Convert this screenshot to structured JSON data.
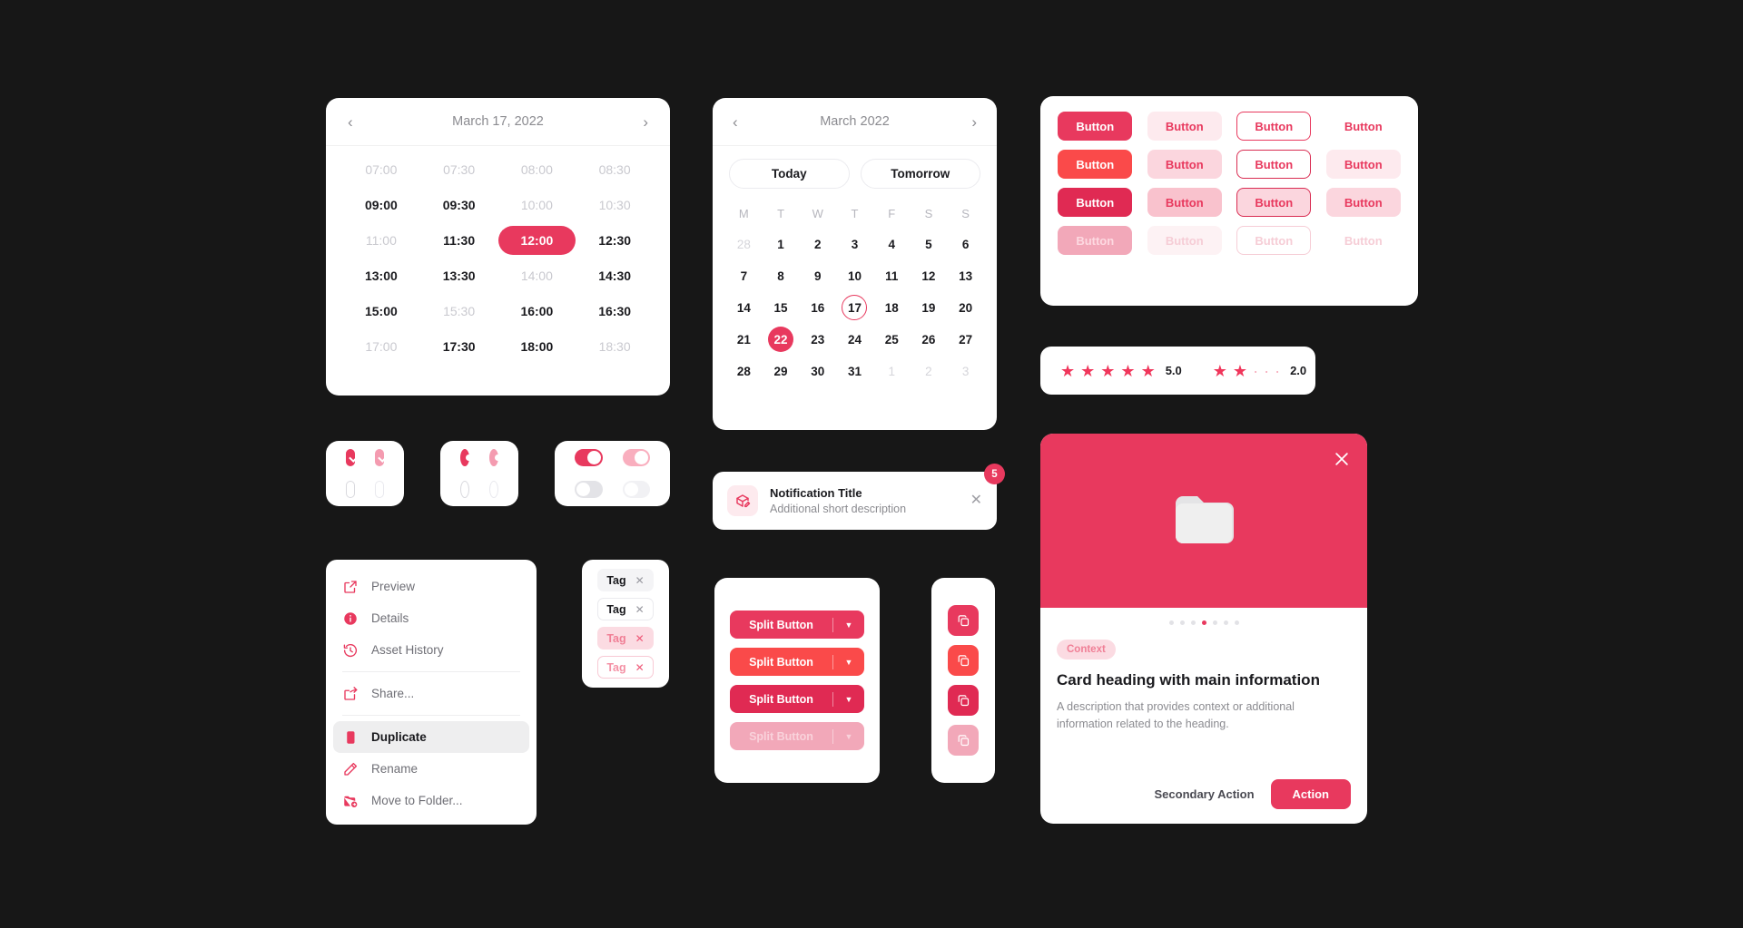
{
  "theme": {
    "accent": "#e8395e",
    "accent_hover": "#fa4a4a",
    "accent_active": "#e02a53",
    "background": "#171717",
    "surface": "#ffffff"
  },
  "time_picker": {
    "title": "March 17, 2022",
    "prev_icon": "chevron-left-icon",
    "next_icon": "chevron-right-icon",
    "slots": [
      {
        "time": "07:00",
        "state": "unavailable"
      },
      {
        "time": "07:30",
        "state": "unavailable"
      },
      {
        "time": "08:00",
        "state": "unavailable"
      },
      {
        "time": "08:30",
        "state": "unavailable"
      },
      {
        "time": "09:00",
        "state": "available"
      },
      {
        "time": "09:30",
        "state": "available"
      },
      {
        "time": "10:00",
        "state": "unavailable"
      },
      {
        "time": "10:30",
        "state": "unavailable"
      },
      {
        "time": "11:00",
        "state": "unavailable"
      },
      {
        "time": "11:30",
        "state": "available"
      },
      {
        "time": "12:00",
        "state": "selected"
      },
      {
        "time": "12:30",
        "state": "available"
      },
      {
        "time": "13:00",
        "state": "available"
      },
      {
        "time": "13:30",
        "state": "available"
      },
      {
        "time": "14:00",
        "state": "unavailable"
      },
      {
        "time": "14:30",
        "state": "available"
      },
      {
        "time": "15:00",
        "state": "available"
      },
      {
        "time": "15:30",
        "state": "unavailable"
      },
      {
        "time": "16:00",
        "state": "available"
      },
      {
        "time": "16:30",
        "state": "available"
      },
      {
        "time": "17:00",
        "state": "unavailable"
      },
      {
        "time": "17:30",
        "state": "available"
      },
      {
        "time": "18:00",
        "state": "available"
      },
      {
        "time": "18:30",
        "state": "unavailable"
      }
    ]
  },
  "calendar": {
    "title": "March 2022",
    "prev_icon": "chevron-left-icon",
    "next_icon": "chevron-right-icon",
    "quick": [
      {
        "label": "Today"
      },
      {
        "label": "Tomorrow"
      }
    ],
    "weekdays": [
      "M",
      "T",
      "W",
      "T",
      "F",
      "S",
      "S"
    ],
    "days": [
      {
        "n": "28",
        "state": "outside"
      },
      {
        "n": "1",
        "state": "normal"
      },
      {
        "n": "2",
        "state": "normal"
      },
      {
        "n": "3",
        "state": "normal"
      },
      {
        "n": "4",
        "state": "normal"
      },
      {
        "n": "5",
        "state": "normal"
      },
      {
        "n": "6",
        "state": "normal"
      },
      {
        "n": "7",
        "state": "normal"
      },
      {
        "n": "8",
        "state": "normal"
      },
      {
        "n": "9",
        "state": "normal"
      },
      {
        "n": "10",
        "state": "normal"
      },
      {
        "n": "11",
        "state": "normal"
      },
      {
        "n": "12",
        "state": "normal"
      },
      {
        "n": "13",
        "state": "normal"
      },
      {
        "n": "14",
        "state": "normal"
      },
      {
        "n": "15",
        "state": "normal"
      },
      {
        "n": "16",
        "state": "normal"
      },
      {
        "n": "17",
        "state": "today"
      },
      {
        "n": "18",
        "state": "normal"
      },
      {
        "n": "19",
        "state": "normal"
      },
      {
        "n": "20",
        "state": "normal"
      },
      {
        "n": "21",
        "state": "normal"
      },
      {
        "n": "22",
        "state": "selected"
      },
      {
        "n": "23",
        "state": "normal"
      },
      {
        "n": "24",
        "state": "normal"
      },
      {
        "n": "25",
        "state": "normal"
      },
      {
        "n": "26",
        "state": "normal"
      },
      {
        "n": "27",
        "state": "normal"
      },
      {
        "n": "28",
        "state": "normal"
      },
      {
        "n": "29",
        "state": "normal"
      },
      {
        "n": "30",
        "state": "normal"
      },
      {
        "n": "31",
        "state": "normal"
      },
      {
        "n": "1",
        "state": "outside"
      },
      {
        "n": "2",
        "state": "outside"
      },
      {
        "n": "3",
        "state": "outside"
      }
    ]
  },
  "button_matrix": {
    "label": "Button",
    "variants": [
      "solid",
      "soft",
      "outline",
      "ghost"
    ],
    "states": [
      "default",
      "hover",
      "active",
      "disabled"
    ],
    "cells": [
      {
        "variant": "solid",
        "state": "default",
        "label": "Button"
      },
      {
        "variant": "soft",
        "state": "default",
        "label": "Button"
      },
      {
        "variant": "outline",
        "state": "default",
        "label": "Button"
      },
      {
        "variant": "ghost",
        "state": "default",
        "label": "Button"
      },
      {
        "variant": "solid",
        "state": "hover",
        "label": "Button"
      },
      {
        "variant": "soft",
        "state": "hover",
        "label": "Button"
      },
      {
        "variant": "outline",
        "state": "hover",
        "label": "Button"
      },
      {
        "variant": "ghost",
        "state": "hover",
        "label": "Button"
      },
      {
        "variant": "solid",
        "state": "active",
        "label": "Button"
      },
      {
        "variant": "soft",
        "state": "active",
        "label": "Button"
      },
      {
        "variant": "outline",
        "state": "active",
        "label": "Button"
      },
      {
        "variant": "ghost",
        "state": "active",
        "label": "Button"
      },
      {
        "variant": "solid",
        "state": "disabled",
        "label": "Button"
      },
      {
        "variant": "soft",
        "state": "disabled",
        "label": "Button"
      },
      {
        "variant": "outline",
        "state": "disabled",
        "label": "Button"
      },
      {
        "variant": "ghost",
        "state": "disabled",
        "label": "Button"
      }
    ]
  },
  "ratings": [
    {
      "filled": 5,
      "total": 5,
      "value": "5.0"
    },
    {
      "filled": 2,
      "total": 5,
      "value": "2.0"
    }
  ],
  "controls": {
    "checkboxes": [
      [
        "on",
        "on-soft"
      ],
      [
        "off",
        "off-light"
      ]
    ],
    "radios": [
      [
        "on",
        "on-soft"
      ],
      [
        "off",
        "off-light"
      ]
    ],
    "switches": [
      [
        "on",
        "on-soft"
      ],
      [
        "off",
        "off-light"
      ]
    ]
  },
  "notification": {
    "icon": "package-edit-icon",
    "title": "Notification Title",
    "description": "Additional short description",
    "close_icon": "close-icon",
    "badge": "5"
  },
  "context_menu": {
    "items": [
      {
        "label": "Preview",
        "icon": "external-link-icon",
        "active": false
      },
      {
        "label": "Details",
        "icon": "info-circle-icon",
        "active": false
      },
      {
        "label": "Asset History",
        "icon": "history-clock-icon",
        "active": false
      },
      {
        "separator": true
      },
      {
        "label": "Share...",
        "icon": "share-arrow-icon",
        "active": false
      },
      {
        "separator": true
      },
      {
        "label": "Duplicate",
        "icon": "duplicate-icon",
        "active": true
      },
      {
        "label": "Rename",
        "icon": "pencil-icon",
        "active": false
      },
      {
        "label": "Move to Folder...",
        "icon": "folder-move-icon",
        "active": false
      }
    ]
  },
  "tags": [
    {
      "label": "Tag",
      "state": "default",
      "remove_icon": "close-icon"
    },
    {
      "label": "Tag",
      "state": "outline",
      "remove_icon": "close-icon"
    },
    {
      "label": "Tag",
      "state": "soft",
      "remove_icon": "close-icon"
    },
    {
      "label": "Tag",
      "state": "soft-outline",
      "remove_icon": "close-icon"
    }
  ],
  "split_buttons": [
    {
      "label": "Split Button",
      "state": "default",
      "caret_icon": "caret-down-icon"
    },
    {
      "label": "Split Button",
      "state": "hover",
      "caret_icon": "caret-down-icon"
    },
    {
      "label": "Split Button",
      "state": "active",
      "caret_icon": "caret-down-icon"
    },
    {
      "label": "Split Button",
      "state": "disabled",
      "caret_icon": "caret-down-icon"
    }
  ],
  "icon_buttons": [
    {
      "icon": "copy-icon",
      "state": "default"
    },
    {
      "icon": "copy-icon",
      "state": "hover"
    },
    {
      "icon": "copy-icon",
      "state": "active"
    },
    {
      "icon": "copy-icon",
      "state": "disabled"
    }
  ],
  "media_card": {
    "hero_icon": "folder-icon",
    "close_icon": "close-icon",
    "dots_total": 7,
    "dots_active_index": 3,
    "chip": "Context",
    "heading": "Card heading with main information",
    "description": "A description that provides context or additional information related to the heading.",
    "secondary_action": "Secondary Action",
    "primary_action": "Action"
  }
}
